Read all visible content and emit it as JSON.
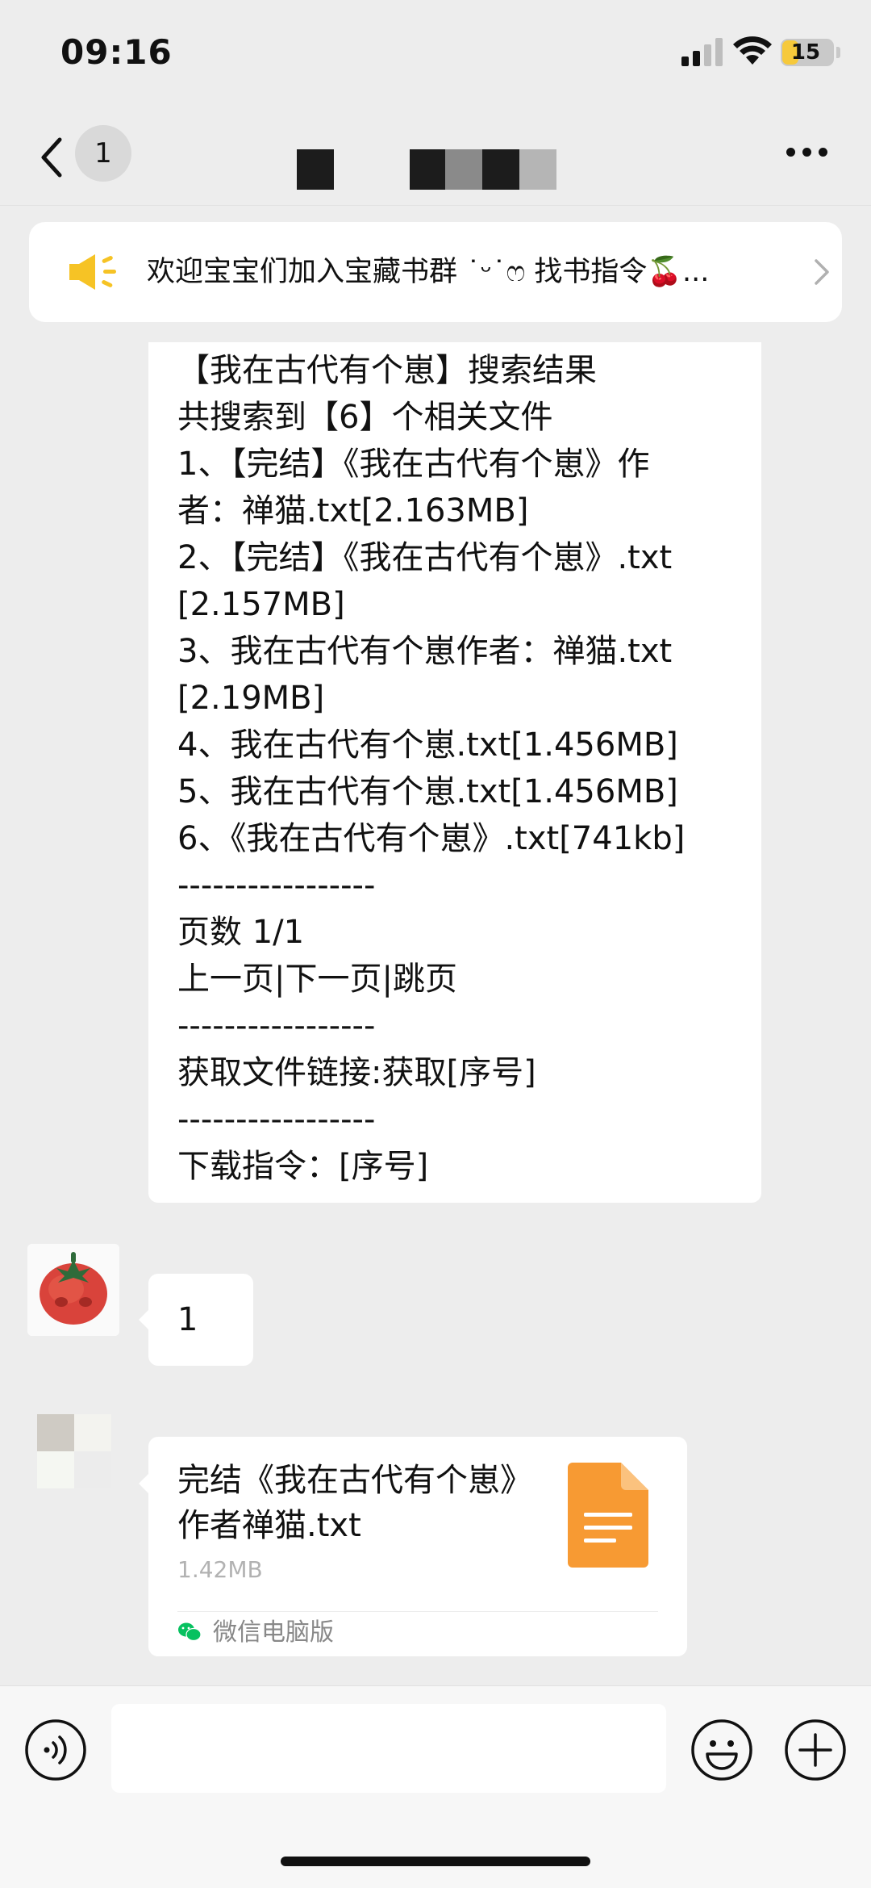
{
  "status_bar": {
    "time": "09:16",
    "battery_level": "15"
  },
  "nav": {
    "unread_count": "1"
  },
  "announcement": {
    "text": "欢迎宝宝们加入宝藏书群 ˙ᵕ˙ෆ 找书指令🍒..."
  },
  "messages": {
    "search_result": {
      "lines": [
        "【我在古代有个崽】搜索结果",
        "共搜索到【6】个相关文件",
        "1、【完结】《我在古代有个崽》作",
        "者：禅猫.txt[2.163MB]",
        "2、【完结】《我在古代有个崽》.txt",
        "[2.157MB]",
        "3、我在古代有个崽作者：禅猫.txt",
        "[2.19MB]",
        "4、我在古代有个崽.txt[1.456MB]",
        "5、我在古代有个崽.txt[1.456MB]",
        "6、《我在古代有个崽》.txt[741kb]",
        "-----------------",
        "页数 1/1",
        "上一页|下一页|跳页",
        "-----------------",
        "获取文件链接:获取[序号]",
        "-----------------",
        "下载指令：[序号]"
      ]
    },
    "user_reply": {
      "text": "1"
    },
    "file_message": {
      "name": "完结《我在古代有个崽》作者禅猫.txt",
      "size": "1.42MB",
      "source": "微信电脑版"
    }
  },
  "input": {
    "placeholder": ""
  },
  "colors": {
    "background": "#ededed",
    "bubble": "#ffffff",
    "battery_fill": "#f6c93b",
    "file_icon": "#f79a33",
    "announcement_icon": "#f6c325",
    "wechat_green": "#07c160"
  },
  "icons": {
    "back": "chevron-left-icon",
    "more": "more-dots-icon",
    "announcement": "megaphone-icon",
    "voice": "voice-icon",
    "emoji": "emoji-icon",
    "plus": "plus-icon",
    "file": "document-icon"
  }
}
